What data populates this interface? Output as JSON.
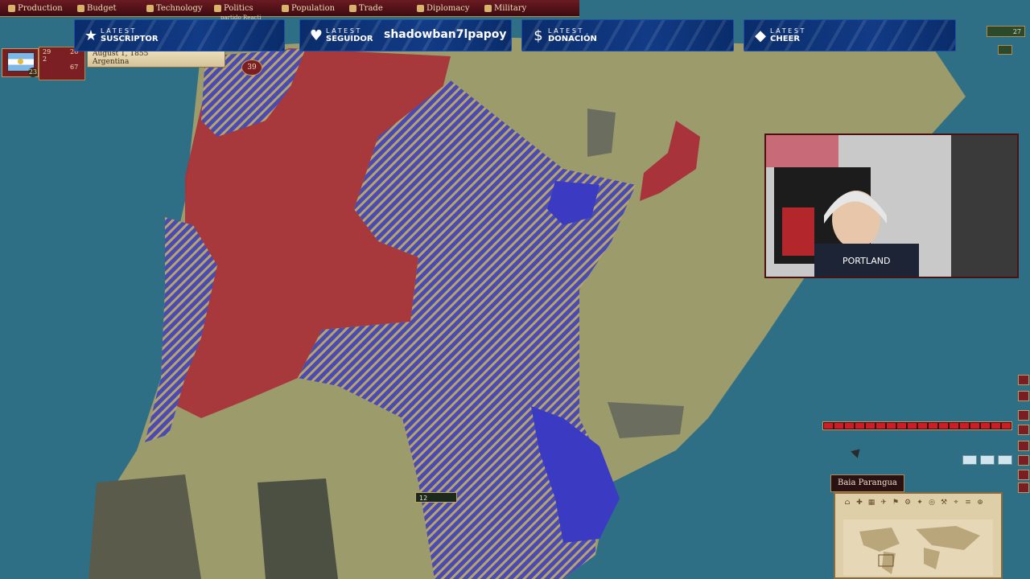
{
  "top_tabs": [
    "Production",
    "Budget",
    "Technology",
    "Politics",
    "Population",
    "Trade",
    "Diplomacy",
    "Military"
  ],
  "subtabs": {
    "politics_sub": "partido Reacti"
  },
  "country": {
    "name": "Argentina",
    "date": "August 1, 1855",
    "level": "23",
    "stats": [
      "29",
      "2",
      "26",
      "67"
    ],
    "flag_badge": "39"
  },
  "banners": [
    {
      "icon": "star-icon",
      "kicker": "LATEST",
      "title": "SUSCRIPTOR",
      "name": ""
    },
    {
      "icon": "heart-icon",
      "kicker": "LATEST",
      "title": "SEGUIDOR",
      "name": "shadowban7lpapoy"
    },
    {
      "icon": "dollar-icon",
      "kicker": "LATEST",
      "title": "DONACIÓN",
      "name": ""
    },
    {
      "icon": "diamond-icon",
      "kicker": "LATEST",
      "title": "CHEER",
      "name": ""
    }
  ],
  "map": {
    "tooltip": "Baia Parangua",
    "unit_label": "12",
    "regions_colors": {
      "sea": "#2f6f86",
      "land": "#9a9a6a",
      "red": "#a8333a",
      "blue_hatch": "#3c3ca8"
    }
  },
  "right_counters": {
    "top_value": "27"
  },
  "progress": {
    "segments": 18,
    "filled": 18
  },
  "minimap_tools": [
    "⌂",
    "✚",
    "▦",
    "✈",
    "⚑",
    "⚙",
    "✦",
    "◎",
    "⚒",
    "⌖",
    "≡",
    "⊕"
  ]
}
